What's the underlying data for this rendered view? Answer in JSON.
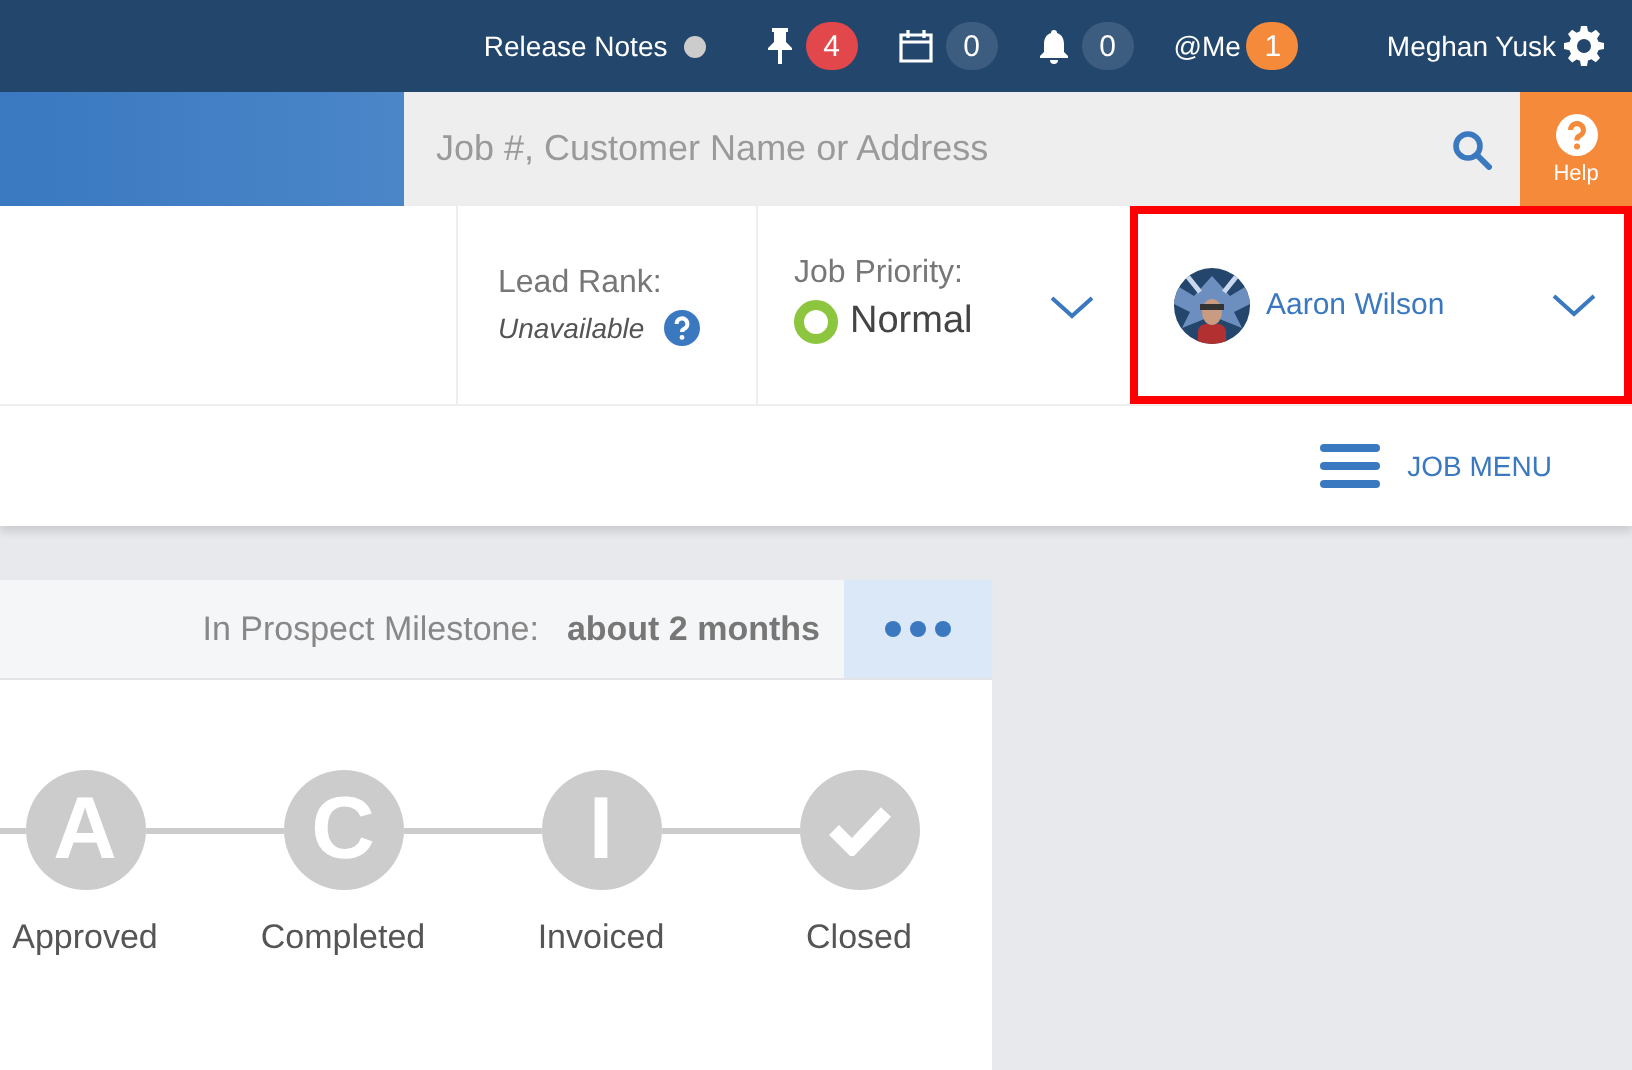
{
  "top_bar": {
    "release_notes": {
      "label": "Release Notes",
      "color": "#cccccc"
    },
    "counters": [
      {
        "kind": "pin",
        "count": "4",
        "color": "#e2474b"
      },
      {
        "kind": "calendar",
        "count": "0",
        "color": "#3d5d80"
      },
      {
        "kind": "bell",
        "count": "0",
        "color": "#3d5d80"
      },
      {
        "kind": "mention",
        "label": "@Me",
        "count": "1",
        "color": "#f58a3a"
      }
    ],
    "user": "Meghan Yusk"
  },
  "search": {
    "placeholder": "Job #, Customer Name or Address"
  },
  "help": {
    "label": "Help"
  },
  "job_header": {
    "lead_rank": {
      "label": "Lead Rank:",
      "value": "Unavailable"
    },
    "job_priority": {
      "label": "Job Priority:",
      "value": "Normal",
      "color": "#8cc63f"
    },
    "owner": {
      "name": "Aaron Wilson",
      "highlighted": true
    }
  },
  "job_menu": {
    "label": "JOB MENU"
  },
  "milestone_card": {
    "label": "In Prospect Milestone:",
    "duration": "about 2 months",
    "steps": [
      {
        "kind": "letter",
        "letter": "A",
        "label": "Approved"
      },
      {
        "kind": "letter",
        "letter": "C",
        "label": "Completed"
      },
      {
        "kind": "letter",
        "letter": "I",
        "label": "Invoiced"
      },
      {
        "kind": "check",
        "label": "Closed"
      }
    ]
  }
}
